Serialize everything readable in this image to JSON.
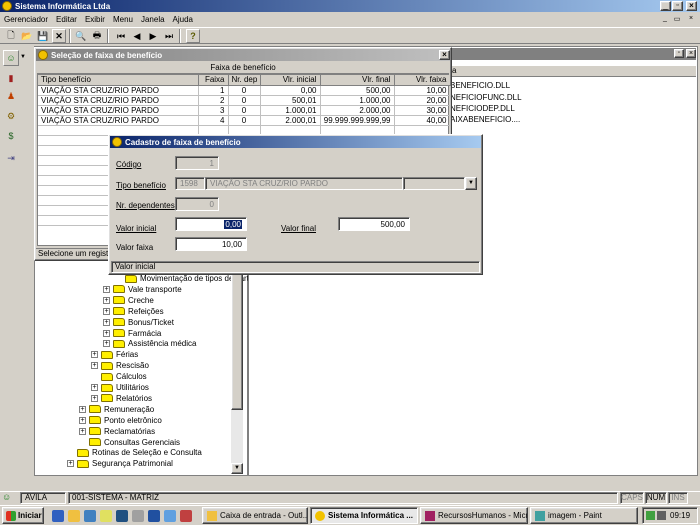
{
  "app": {
    "title": "Sistema Informática Ltda"
  },
  "menu": [
    "Gerenciador",
    "Editar",
    "Exibir",
    "Menu",
    "Janela",
    "Ajuda"
  ],
  "selection_window": {
    "title": "Seleção de faixa de benefício",
    "header": "Faixa de benefício",
    "columns": [
      "Tipo benefício",
      "Faixa",
      "Nr. dep",
      "Vlr. inicial",
      "Vlr. final",
      "Vlr. faixa"
    ],
    "rows": [
      [
        "VIAÇÃO STA CRUZ/RIO PARDO",
        "1",
        "0",
        "0,00",
        "500,00",
        "10,00"
      ],
      [
        "VIAÇÃO STA CRUZ/RIO PARDO",
        "2",
        "0",
        "500,01",
        "1.000,00",
        "20,00"
      ],
      [
        "VIAÇÃO STA CRUZ/RIO PARDO",
        "3",
        "0",
        "1.000,01",
        "2.000,00",
        "30,00"
      ],
      [
        "VIAÇÃO STA CRUZ/RIO PARDO",
        "4",
        "0",
        "2.000,01",
        "99.999.999.999,99",
        "40,00"
      ]
    ],
    "status": "Selecione um registro"
  },
  "right_panel": {
    "header": "a",
    "files": [
      "BENEFICIO.DLL",
      "NEFICIOFUNC.DLL",
      "NEFICIODEP.DLL",
      "AIXABENEFICIO...."
    ]
  },
  "dialog": {
    "title": "Cadastro de faixa de benefício",
    "codigo_label": "Código",
    "codigo_value": "1",
    "tipo_label": "Tipo benefício",
    "tipo_code": "1598",
    "tipo_name": "VIAÇÃO STA CRUZ/RIO PARDO",
    "nrdep_label": "Nr. dependentes",
    "nrdep_value": "0",
    "vinicial_label": "Valor inicial",
    "vinicial_value": "0,00",
    "vfinal_label": "Valor final",
    "vfinal_value": "500,00",
    "vfaixa_label": "Valor faixa",
    "vfaixa_value": "10,00",
    "status": "Valor inicial"
  },
  "tree": [
    {
      "label": "Movimentação de tipos de cartão",
      "indent": 3,
      "pm": ""
    },
    {
      "label": "Vale transporte",
      "indent": 2,
      "pm": "+"
    },
    {
      "label": "Creche",
      "indent": 2,
      "pm": "+"
    },
    {
      "label": "Refeições",
      "indent": 2,
      "pm": "+"
    },
    {
      "label": "Bonus/Ticket",
      "indent": 2,
      "pm": "+"
    },
    {
      "label": "Farmácia",
      "indent": 2,
      "pm": "+"
    },
    {
      "label": "Assistência médica",
      "indent": 2,
      "pm": "+"
    },
    {
      "label": "Férias",
      "indent": 1,
      "pm": "+"
    },
    {
      "label": "Rescisão",
      "indent": 1,
      "pm": "+"
    },
    {
      "label": "Cálculos",
      "indent": 1,
      "pm": ""
    },
    {
      "label": "Utilitários",
      "indent": 1,
      "pm": "+"
    },
    {
      "label": "Relatórios",
      "indent": 1,
      "pm": "+"
    },
    {
      "label": "Remuneração",
      "indent": 0,
      "pm": "+"
    },
    {
      "label": "Ponto eletrônico",
      "indent": 0,
      "pm": "+"
    },
    {
      "label": "Reclamatórias",
      "indent": 0,
      "pm": "+"
    },
    {
      "label": "Consultas Gerenciais",
      "indent": 0,
      "pm": ""
    },
    {
      "label": "Rotinas de Seleção e Consulta",
      "indent": -1,
      "pm": ""
    },
    {
      "label": "Segurança Patrimonial",
      "indent": -1,
      "pm": "+"
    }
  ],
  "statusbar": {
    "user": "AVILA",
    "company": "001-SISTEMA - MATRIZ",
    "caps": "CAPS",
    "num": "NUM",
    "ins": "INS"
  },
  "taskbar": {
    "start": "Iniciar",
    "items": [
      "Caixa de entrada - Outl...",
      "Sistema Informática ...",
      "RecursosHumanos - Micr...",
      "imagem - Paint"
    ],
    "clock": "09:19"
  }
}
